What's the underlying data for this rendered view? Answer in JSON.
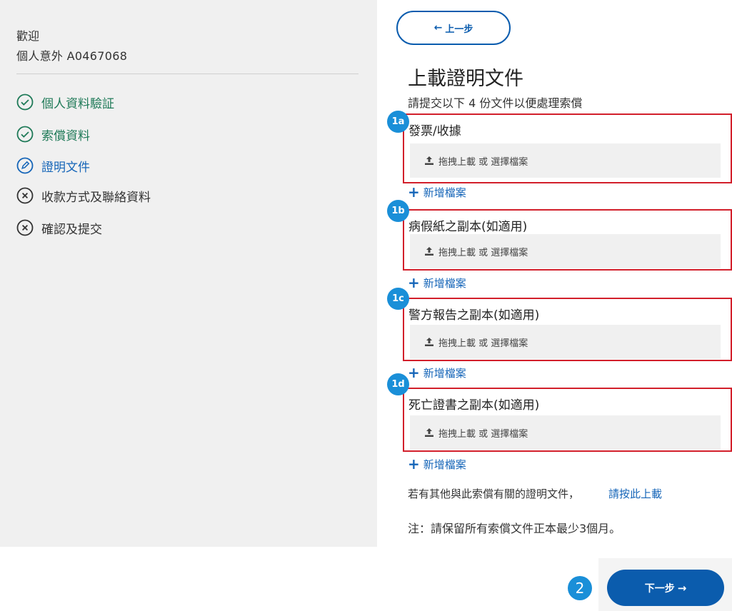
{
  "sidebar": {
    "welcome": "歡迎",
    "policy": "個人意外 A0467068",
    "steps": [
      {
        "label": "個人資料驗証",
        "status": "done"
      },
      {
        "label": "索償資料",
        "status": "done"
      },
      {
        "label": "證明文件",
        "status": "current"
      },
      {
        "label": "收款方式及聯絡資料",
        "status": "pending"
      },
      {
        "label": "確認及提交",
        "status": "pending"
      }
    ]
  },
  "main": {
    "back_label": "上一步",
    "title": "上載證明文件",
    "subtitle": "請提交以下 4 份文件以便處理索償",
    "upload_prompt": "拖拽上載 或 選擇檔案",
    "add_file_label": "新增檔案",
    "documents": [
      {
        "badge": "1a",
        "title": "發票/收據"
      },
      {
        "badge": "1b",
        "title": "病假紙之副本(如適用)"
      },
      {
        "badge": "1c",
        "title": "警方報告之副本(如適用)"
      },
      {
        "badge": "1d",
        "title": "死亡證書之副本(如適用)"
      }
    ],
    "other_docs_text": "若有其他與此索償有關的證明文件，",
    "other_docs_link": "請按此上載",
    "note": "注：請保留所有索償文件正本最少3個月。"
  },
  "footer": {
    "badge": "2",
    "next_label": "下一步"
  },
  "colors": {
    "accent_blue": "#0b5cad",
    "done_green": "#1f7a58",
    "current_blue": "#1565b8",
    "highlight_red": "#d21f2b",
    "badge_blue": "#1a8fd8"
  },
  "icons": {
    "done": "check-circle-icon",
    "current": "pencil-circle-icon",
    "pending": "x-circle-icon",
    "upload": "upload-icon",
    "add": "plus-icon",
    "back": "arrow-left-icon",
    "next": "arrow-right-icon"
  }
}
